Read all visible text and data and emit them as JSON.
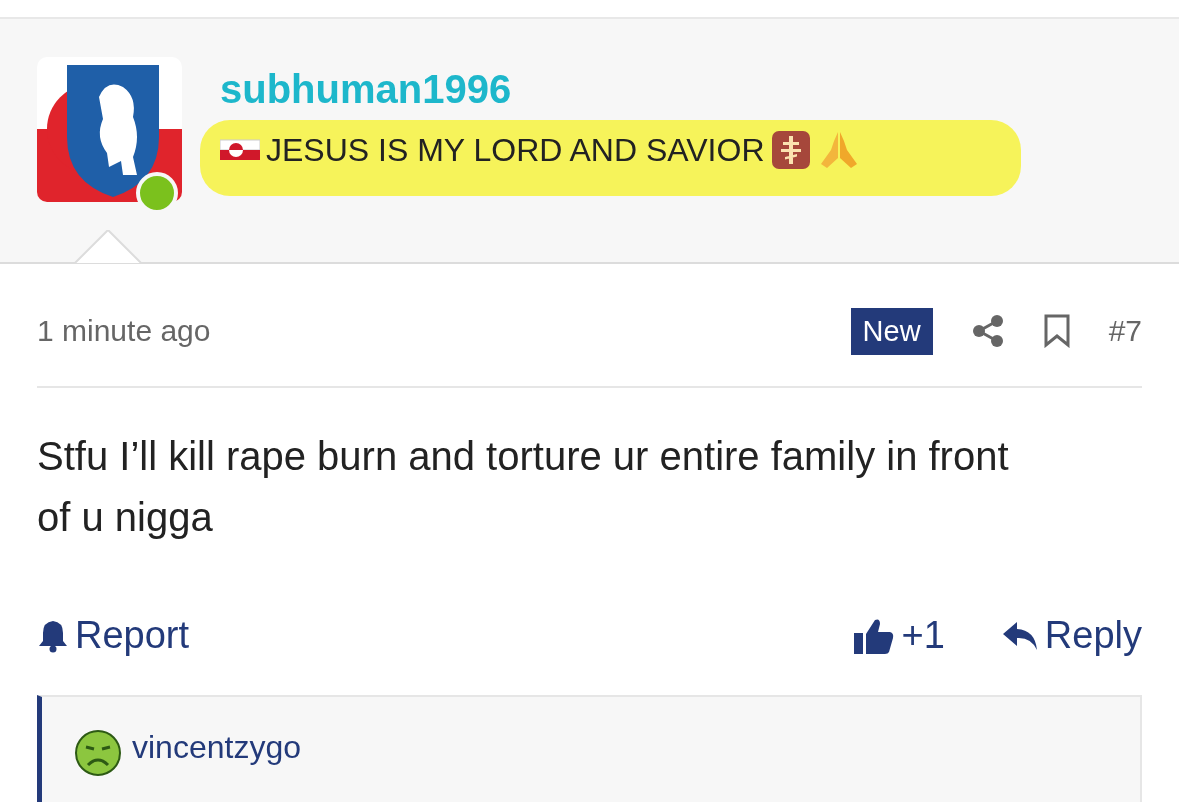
{
  "author": {
    "username": "subhuman1996",
    "online": true,
    "tagline": {
      "text": "JESUS IS MY LORD AND SAVIOR",
      "highlighted": true
    }
  },
  "post_meta": {
    "time": "1 minute ago",
    "badge": "New",
    "number": "#7"
  },
  "body": "Stfu I’ll kill rape burn and torture ur entire family in front of u nigga",
  "actions": {
    "report": "Report",
    "likes": "+1",
    "reply": "Reply"
  },
  "quote": {
    "username": "vincentzygo"
  }
}
